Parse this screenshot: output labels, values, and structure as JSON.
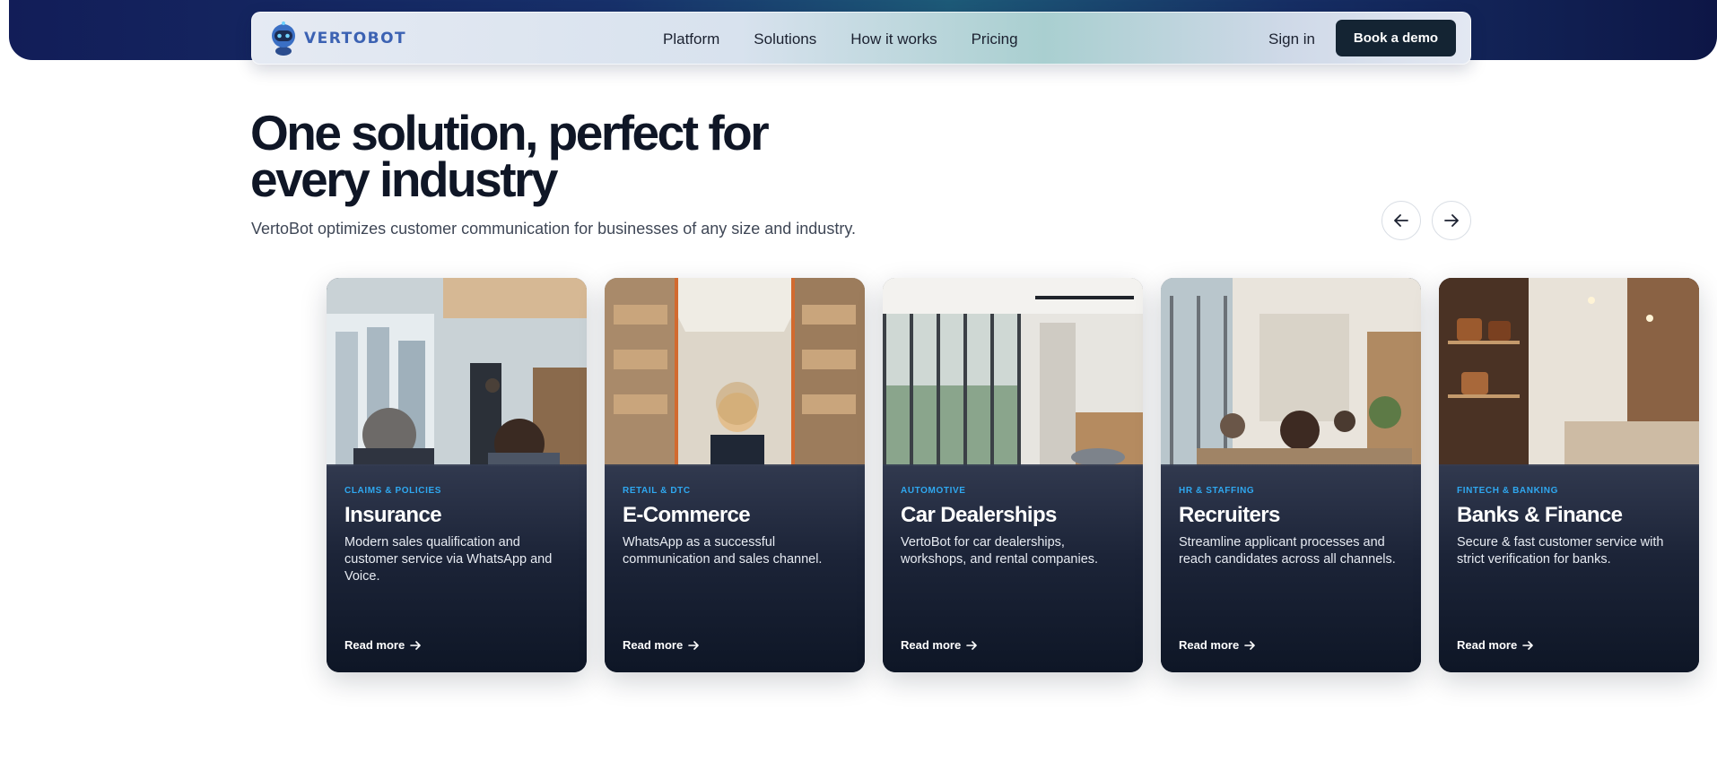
{
  "header": {
    "logo_text": "VERTOBOT",
    "nav": [
      "Platform",
      "Solutions",
      "How it works",
      "Pricing"
    ],
    "sign_in": "Sign in",
    "cta": "Book a demo"
  },
  "hero": {
    "title_line1": "One solution, perfect for",
    "title_line2": "every industry",
    "subtitle": "VertoBot optimizes customer communication for businesses of any size and industry."
  },
  "carousel": {
    "prev_icon": "arrow-left-icon",
    "next_icon": "arrow-right-icon"
  },
  "cards": [
    {
      "tag": "Claims & Policies",
      "title": "Insurance",
      "description": "Modern sales qualification and customer service via WhatsApp and Voice.",
      "link": "Read more"
    },
    {
      "tag": "Retail & DTC",
      "title": "E-Commerce",
      "description": "WhatsApp as a successful communication and sales channel.",
      "link": "Read more"
    },
    {
      "tag": "Automotive",
      "title": "Car Dealerships",
      "description": "VertoBot for car dealerships, workshops, and rental companies.",
      "link": "Read more"
    },
    {
      "tag": "HR & Staffing",
      "title": "Recruiters",
      "description": "Streamline applicant processes and reach candidates across all channels.",
      "link": "Read more"
    },
    {
      "tag": "Fintech & Banking",
      "title": "Banks & Finance",
      "description": "Secure & fast customer service with strict verification for banks.",
      "link": "Read more"
    }
  ],
  "colors": {
    "brand_navy": "#121d58",
    "cta_bg": "#142433",
    "tag_blue": "#2fa8f0",
    "logo_blue": "#3c62b3"
  }
}
